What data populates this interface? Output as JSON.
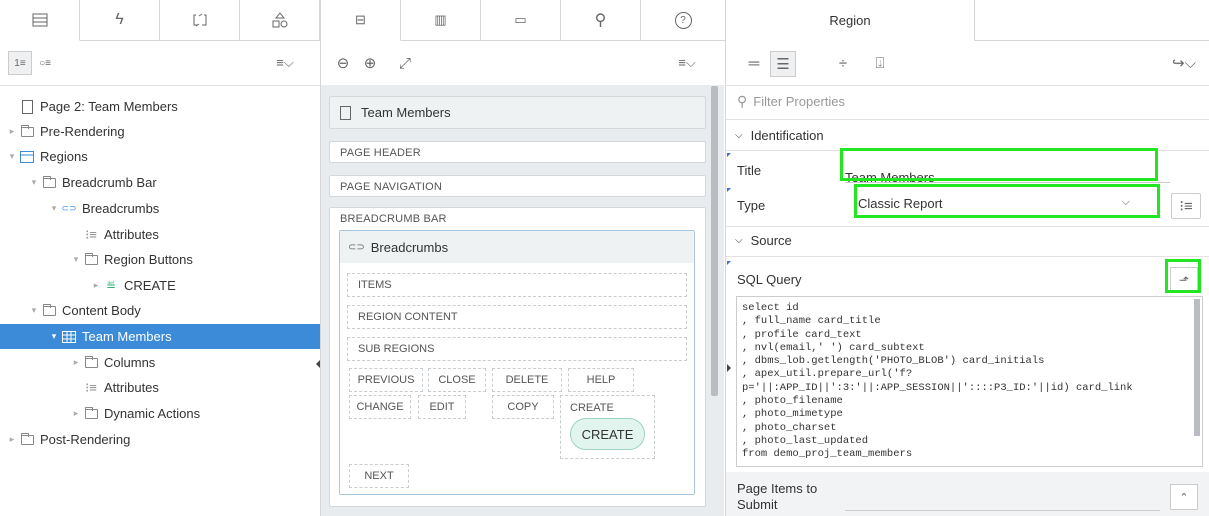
{
  "left_panel": {
    "tabs": [
      "rendering-tab",
      "dynamic-actions-tab",
      "processing-tab",
      "shared-components-tab"
    ],
    "tree": [
      {
        "label": "Page 2: Team Members",
        "icon": "page-icon"
      },
      {
        "label": "Pre-Rendering",
        "icon": "folder-icon"
      },
      {
        "label": "Regions",
        "icon": "region-icon"
      },
      {
        "label": "Breadcrumb Bar",
        "icon": "folder-open-icon"
      },
      {
        "label": "Breadcrumbs",
        "icon": "breadcrumb-icon"
      },
      {
        "label": "Attributes",
        "icon": "attributes-icon"
      },
      {
        "label": "Region Buttons",
        "icon": "folder-open-icon"
      },
      {
        "label": "CREATE",
        "icon": "button-icon"
      },
      {
        "label": "Content Body",
        "icon": "folder-open-icon"
      },
      {
        "label": "Team Members",
        "icon": "report-icon"
      },
      {
        "label": "Columns",
        "icon": "folder-icon"
      },
      {
        "label": "Attributes",
        "icon": "attributes-icon"
      },
      {
        "label": "Dynamic Actions",
        "icon": "folder-icon"
      },
      {
        "label": "Post-Rendering",
        "icon": "folder-icon"
      }
    ]
  },
  "center_panel": {
    "page_title": "Team Members",
    "page_header": "PAGE HEADER",
    "page_navigation": "PAGE NAVIGATION",
    "breadcrumb_bar": "BREADCRUMB BAR",
    "breadcrumbs_region": "Breadcrumbs",
    "items": "ITEMS",
    "region_content": "REGION CONTENT",
    "sub_regions": "SUB REGIONS",
    "positions": {
      "previous": "PREVIOUS",
      "close": "CLOSE",
      "delete": "DELETE",
      "help": "HELP",
      "change": "CHANGE",
      "edit": "EDIT",
      "copy": "COPY",
      "create": "CREATE",
      "next": "NEXT"
    },
    "create_button": "CREATE"
  },
  "right_panel": {
    "tab": "Region",
    "filter_placeholder": "Filter Properties",
    "identification": "Identification",
    "title_label": "Title",
    "title_value": "Team Members",
    "type_label": "Type",
    "type_value": "Classic Report",
    "source": "Source",
    "sql_label": "SQL Query",
    "sql_lines": [
      "select id",
      ", full_name card_title",
      ", profile card_text",
      ", nvl(email,' ') card_subtext",
      ", dbms_lob.getlength('PHOTO_BLOB') card_initials",
      ", apex_util.prepare_url('f?",
      "p='||:APP_ID||':3:'||:APP_SESSION||'::::P3_ID:'||id) card_link",
      ", photo_filename",
      ", photo_mimetype",
      ", photo_charset",
      ", photo_last_updated",
      "from demo_proj_team_members"
    ],
    "page_items_label_1": "Page Items to",
    "page_items_label_2": "Submit"
  },
  "colors": {
    "selection": "#3b8bd9",
    "highlight": "#22e622"
  }
}
